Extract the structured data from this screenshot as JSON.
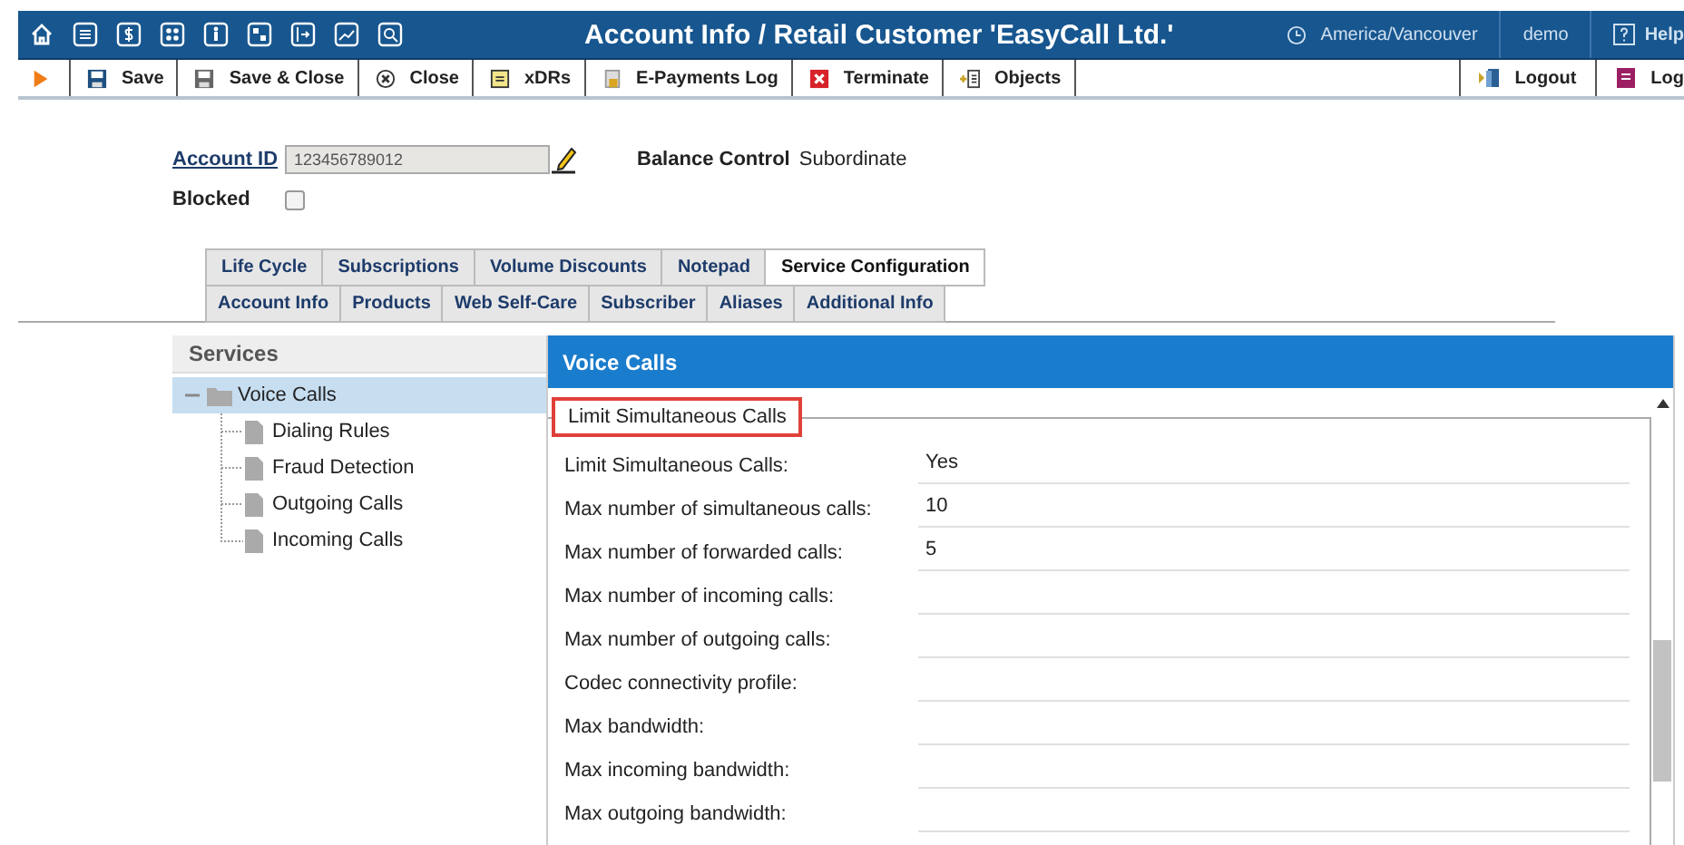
{
  "header": {
    "title": "Account Info / Retail Customer 'EasyCall Ltd.'",
    "timezone": "America/Vancouver",
    "user": "demo",
    "help": "Help"
  },
  "toolbar": {
    "left": [
      {
        "kind": "run"
      },
      {
        "kind": "save",
        "label": "Save"
      },
      {
        "kind": "save-close",
        "label": "Save & Close"
      },
      {
        "kind": "close",
        "label": "Close"
      },
      {
        "kind": "xdrs",
        "label": "xDRs"
      },
      {
        "kind": "payments",
        "label": "E-Payments Log"
      },
      {
        "kind": "terminate",
        "label": "Terminate"
      },
      {
        "kind": "objects",
        "label": "Objects"
      }
    ],
    "right": [
      {
        "kind": "logout",
        "label": "Logout"
      },
      {
        "kind": "log",
        "label": "Log"
      }
    ]
  },
  "account": {
    "id_label": "Account ID",
    "id_value": "123456789012",
    "balance_label": "Balance Control",
    "balance_value": "Subordinate",
    "blocked_label": "Blocked",
    "blocked": false
  },
  "tabs": [
    [
      {
        "label": "Life Cycle",
        "selected": false
      },
      {
        "label": "Subscriptions",
        "selected": false
      },
      {
        "label": "Volume Discounts",
        "selected": false
      },
      {
        "label": "Notepad",
        "selected": false
      },
      {
        "label": "Service Configuration",
        "selected": true
      }
    ],
    [
      {
        "label": "Account Info",
        "selected": false
      },
      {
        "label": "Products",
        "selected": false
      },
      {
        "label": "Web Self-Care",
        "selected": false
      },
      {
        "label": "Subscriber",
        "selected": false
      },
      {
        "label": "Aliases",
        "selected": false
      },
      {
        "label": "Additional Info",
        "selected": false
      }
    ]
  ],
  "services": {
    "title": "Services",
    "tree": [
      {
        "label": "Voice Calls",
        "selected": true,
        "expanded": true,
        "children": [
          {
            "label": "Dialing Rules",
            "selected": false
          },
          {
            "label": "Fraud Detection",
            "selected": false
          },
          {
            "label": "Outgoing Calls",
            "selected": false
          },
          {
            "label": "Incoming Calls",
            "selected": false
          }
        ]
      }
    ]
  },
  "panel": {
    "title": "Voice Calls",
    "group": "Limit Simultaneous Calls",
    "fields": [
      {
        "label": "Limit Simultaneous Calls:",
        "value": "Yes"
      },
      {
        "label": "Max number of simultaneous calls:",
        "value": "10"
      },
      {
        "label": "Max number of forwarded calls:",
        "value": "5"
      },
      {
        "label": "Max number of incoming calls:"
      },
      {
        "label": "Max number of outgoing calls:"
      },
      {
        "label": "Codec connectivity profile:"
      },
      {
        "label": "Max bandwidth:"
      },
      {
        "label": "Max incoming bandwidth:"
      },
      {
        "label": "Max outgoing bandwidth:"
      }
    ]
  }
}
